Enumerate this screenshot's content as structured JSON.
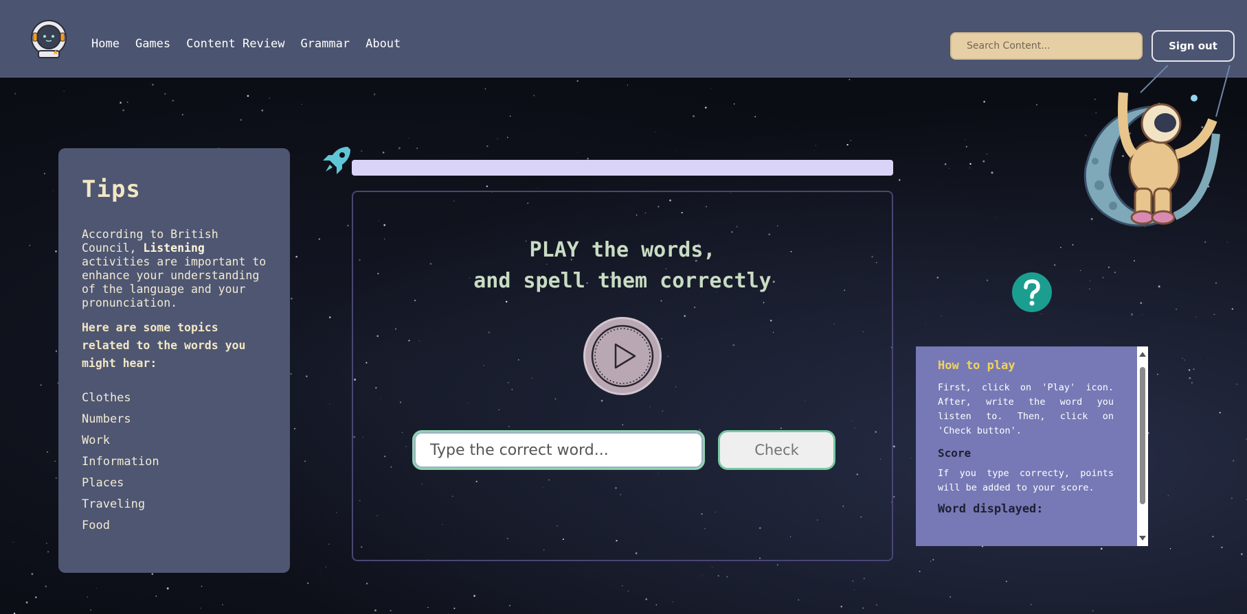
{
  "nav": {
    "links": [
      "Home",
      "Games",
      "Content Review",
      "Grammar",
      "About"
    ],
    "search_placeholder": "Search Content...",
    "signout_label": "Sign out"
  },
  "tips": {
    "title": "Tips",
    "intro_before": "According to British Council, ",
    "intro_bold": "Listening",
    "intro_after": " activities are important to enhance your understanding of the language and your pronunciation.",
    "topics_heading": "Here are some topics related to the words you might hear:",
    "topics": [
      "Clothes",
      "Numbers",
      "Work",
      "Information",
      "Places",
      "Traveling",
      "Food"
    ]
  },
  "progress": {
    "fraction": 0
  },
  "game": {
    "title_line1": "PLAY the words,",
    "title_line2": "and spell them correctly",
    "input_placeholder": "Type the correct word...",
    "check_label": "Check"
  },
  "help": {
    "title": "How to play",
    "text": "First, click on 'Play' icon. After, write the word you listen to. Then, click on 'Check button'.",
    "score_heading": "Score",
    "score_text": "If you type correcty, points will be added to your score.",
    "word_heading": "Word displayed:"
  },
  "stray_text": "--> -->",
  "colors": {
    "navbar": "#4b5470",
    "tips_panel": "#4e5672",
    "help_panel": "#7679b5",
    "help_button": "#1b9e8f",
    "accent_yellow": "#f1d35b",
    "search_bg": "#e7cfa5"
  },
  "icons": [
    "astronaut-logo-icon",
    "rocket-icon",
    "play-icon",
    "question-icon",
    "astronaut-moon-icon"
  ]
}
